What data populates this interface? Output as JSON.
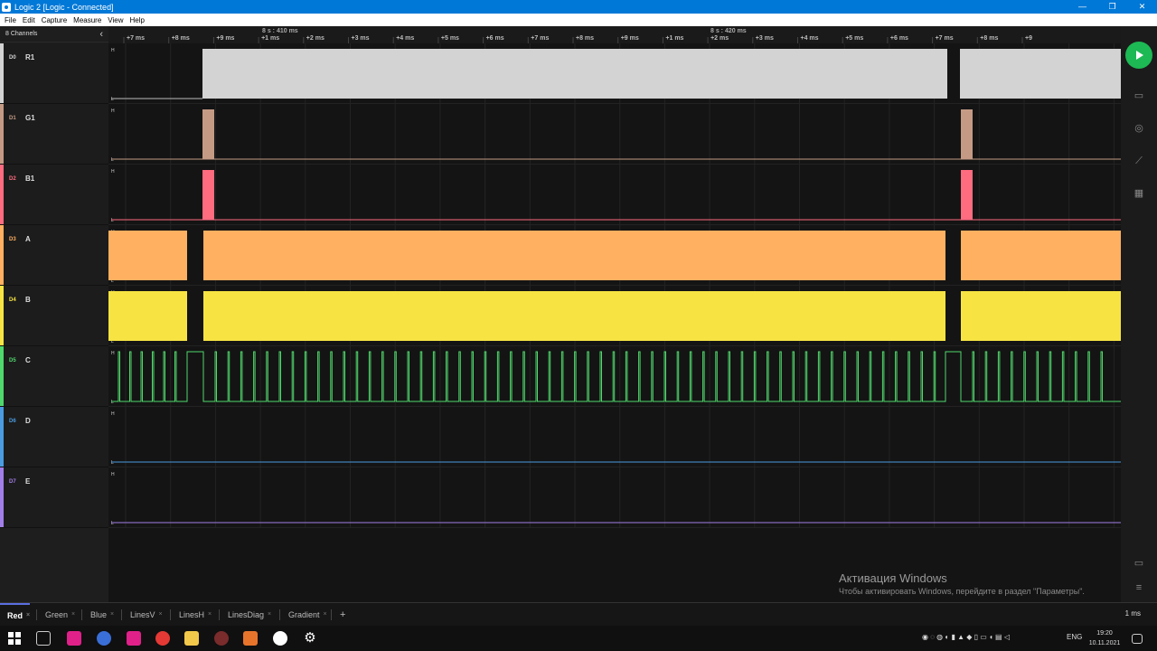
{
  "window": {
    "title": "Logic 2 [Logic - Connected]",
    "controls": [
      "—",
      "❐",
      "✕"
    ]
  },
  "menu": [
    "File",
    "Edit",
    "Capture",
    "Measure",
    "View",
    "Help"
  ],
  "sidebar": {
    "title": "8 Channels",
    "collapse": "‹"
  },
  "channels": [
    {
      "idx": "D0",
      "name": "R1",
      "color": "#d3d3d3",
      "hl_h": "H",
      "hl_l": "L"
    },
    {
      "idx": "D1",
      "name": "G1",
      "color": "#c49a84",
      "hl_h": "H",
      "hl_l": "L"
    },
    {
      "idx": "D2",
      "name": "B1",
      "color": "#ff6b7f",
      "hl_h": "H",
      "hl_l": "L"
    },
    {
      "idx": "D3",
      "name": "A",
      "color": "#ffb060",
      "hl_h": "H",
      "hl_l": "L"
    },
    {
      "idx": "D4",
      "name": "B",
      "color": "#f7e443",
      "hl_h": "H",
      "hl_l": "L"
    },
    {
      "idx": "D5",
      "name": "C",
      "color": "#4fd86b",
      "hl_h": "H",
      "hl_l": "L"
    },
    {
      "idx": "D6",
      "name": "D",
      "color": "#4a9be0",
      "hl_h": "H",
      "hl_l": "L"
    },
    {
      "idx": "D7",
      "name": "E",
      "color": "#a27ee8",
      "hl_h": "H",
      "hl_l": "L"
    }
  ],
  "timeline": {
    "group_labels": [
      "8 s : 410 ms",
      "8 s : 420 ms"
    ],
    "ticks": [
      "+7 ms",
      "+8 ms",
      "+9 ms",
      "+1 ms",
      "+2 ms",
      "+3 ms",
      "+4 ms",
      "+5 ms",
      "+6 ms",
      "+7 ms",
      "+8 ms",
      "+9 ms",
      "+1 ms",
      "+2 ms",
      "+3 ms",
      "+4 ms",
      "+5 ms",
      "+6 ms",
      "+7 ms",
      "+8 ms",
      "+9"
    ]
  },
  "tabs": [
    {
      "label": "Red",
      "close": "×"
    },
    {
      "label": "Green",
      "close": "×"
    },
    {
      "label": "Blue",
      "close": "×"
    },
    {
      "label": "LinesV",
      "close": "×"
    },
    {
      "label": "LinesH",
      "close": "×"
    },
    {
      "label": "LinesDiag",
      "close": "×"
    },
    {
      "label": "Gradient",
      "close": "×"
    }
  ],
  "add_tab": "+",
  "zoom_level": "1 ms",
  "watermark": {
    "title": "Активация Windows",
    "text": "Чтобы активировать Windows, перейдите в раздел \"Параметры\"."
  },
  "taskbar": {
    "lang": "ENG",
    "time": "19:20",
    "date": "10.11.2021"
  },
  "icons": {
    "play": "play-icon",
    "annotations": "annotations-icon",
    "analyzers": "analyzers-icon",
    "measure": "measure-icon",
    "extensions": "extensions-icon",
    "notes": "notes-icon",
    "menu": "menu-icon"
  }
}
